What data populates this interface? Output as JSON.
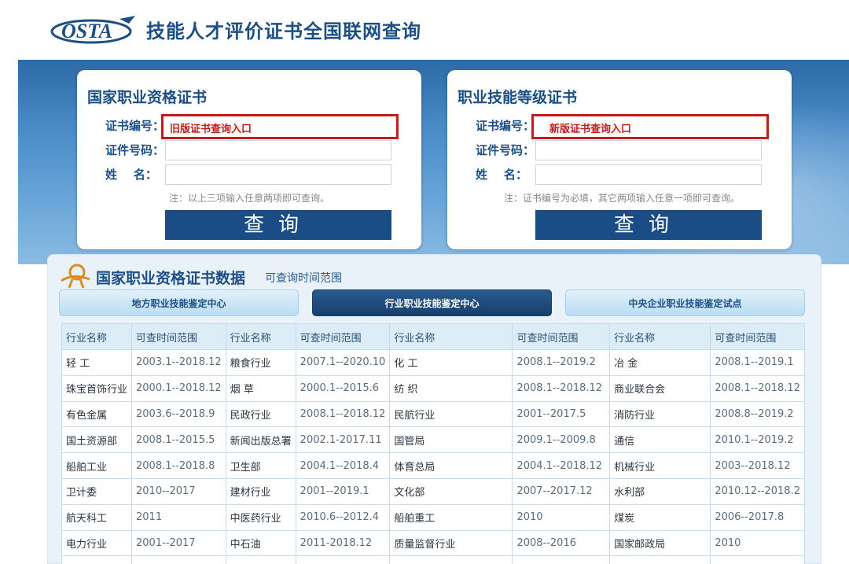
{
  "header": {
    "logo_text": "OSTA",
    "title": "技能人才评价证书全国联网查询"
  },
  "cards": {
    "left": {
      "title": "国家职业资格证书",
      "label_cert": "证书编号：",
      "label_id": "证件号码：",
      "label_name": "姓    名：",
      "cert_hint": "旧版证书查询入口",
      "note": "注：以上三项输入任意两项即可查询。",
      "button": "查询"
    },
    "right": {
      "title": "职业技能等级证书",
      "label_cert": "证书编号：",
      "label_id": "证件号码：",
      "label_name": "姓    名：",
      "cert_hint": "新版证书查询入口",
      "note": "注：证书编号为必填，其它两项输入任意一项即可查询。",
      "button": "查询"
    }
  },
  "panel": {
    "title": "国家职业资格证书数据",
    "subtitle": "可查询时间范围",
    "tabs": [
      "地方职业技能鉴定中心",
      "行业职业技能鉴定中心",
      "中央企业职业技能鉴定试点"
    ],
    "active_tab": 1
  },
  "table": {
    "headers": [
      "行业名称",
      "可查时间范围",
      "行业名称",
      "可查时间范围",
      "行业名称",
      "可查时间范围",
      "行业名称",
      "可查时间范围"
    ],
    "rows": [
      [
        "轻 工",
        "2003.1--2018.12",
        "粮食行业",
        "2007.1--2020.10",
        "化 工",
        "2008.1--2019.2",
        "冶 金",
        "2008.1--2019.1"
      ],
      [
        "珠宝首饰行业",
        "2000.1--2018.12",
        "烟 草",
        "2000.1--2015.6",
        "纺 织",
        "2008.1--2018.12",
        "商业联合会",
        "2008.1--2018.12"
      ],
      [
        "有色金属",
        "2003.6--2018.9",
        "民政行业",
        "2008.1--2018.12",
        "民航行业",
        "2001--2017.5",
        "消防行业",
        "2008.8--2019.2"
      ],
      [
        "国土资源部",
        "2008.1--2015.5",
        "新闻出版总署",
        "2002.1-2017.11",
        "国管局",
        "2009.1--2009.8",
        "通信",
        "2010.1--2019.2"
      ],
      [
        "船舶工业",
        "2008.1--2018.8",
        "卫生部",
        "2004.1--2018.4",
        "体育总局",
        "2004.1--2018.12",
        "机械行业",
        "2003--2018.12"
      ],
      [
        "卫计委",
        "2010--2017",
        "建材行业",
        "2001--2019.1",
        "文化部",
        "2007--2017.12",
        "水利部",
        "2010.12--2018.2"
      ],
      [
        "航天科工",
        "2011",
        "中医药行业",
        "2010.6--2012.4",
        "船舶重工",
        "2010",
        "煤炭",
        "2006--2017.8"
      ],
      [
        "电力行业",
        "2001--2017",
        "中石油",
        "2011-2018.12",
        "质量监督行业",
        "2008--2016",
        "国家邮政局",
        "2010"
      ],
      [
        "",
        "",
        "",
        "",
        "",
        "",
        "",
        ""
      ]
    ]
  },
  "colors": {
    "brand_blue": "#1c4f86",
    "highlight_red": "#c41b1b",
    "button_blue": "#1a4d86"
  }
}
